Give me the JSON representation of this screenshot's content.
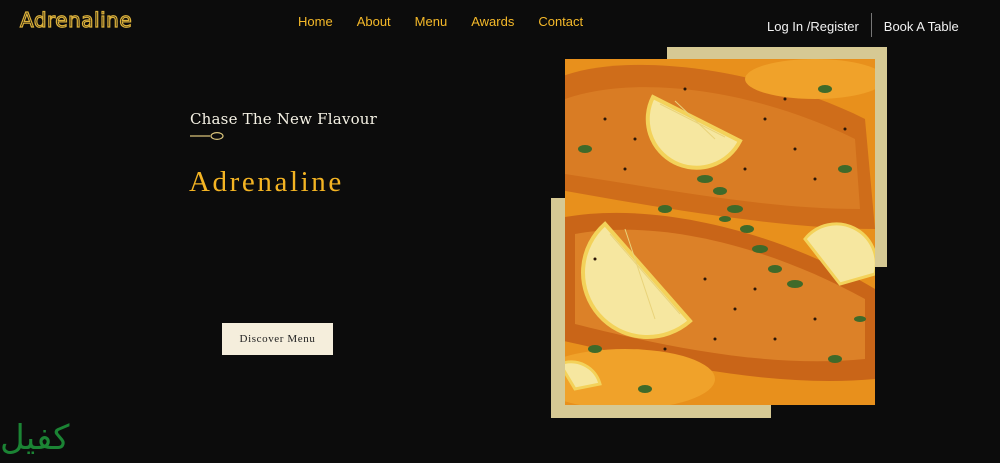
{
  "brand": {
    "logo": "Adrenaline"
  },
  "nav": {
    "items": [
      "Home",
      "About",
      "Menu",
      "Awards",
      "Contact"
    ]
  },
  "auth": {
    "login": "Log In /Register",
    "book": "Book A Table"
  },
  "hero": {
    "kicker": "Chase The New Flavour",
    "title": "Adrenaline",
    "cta": "Discover Menu"
  },
  "watermark": "كفيل",
  "colors": {
    "background": "#0c0c0c",
    "accent_gold": "#f5b929",
    "frame": "#d6c994",
    "button_bg": "#f5eedc"
  },
  "icons": [
    "spoon-divider-icon"
  ]
}
